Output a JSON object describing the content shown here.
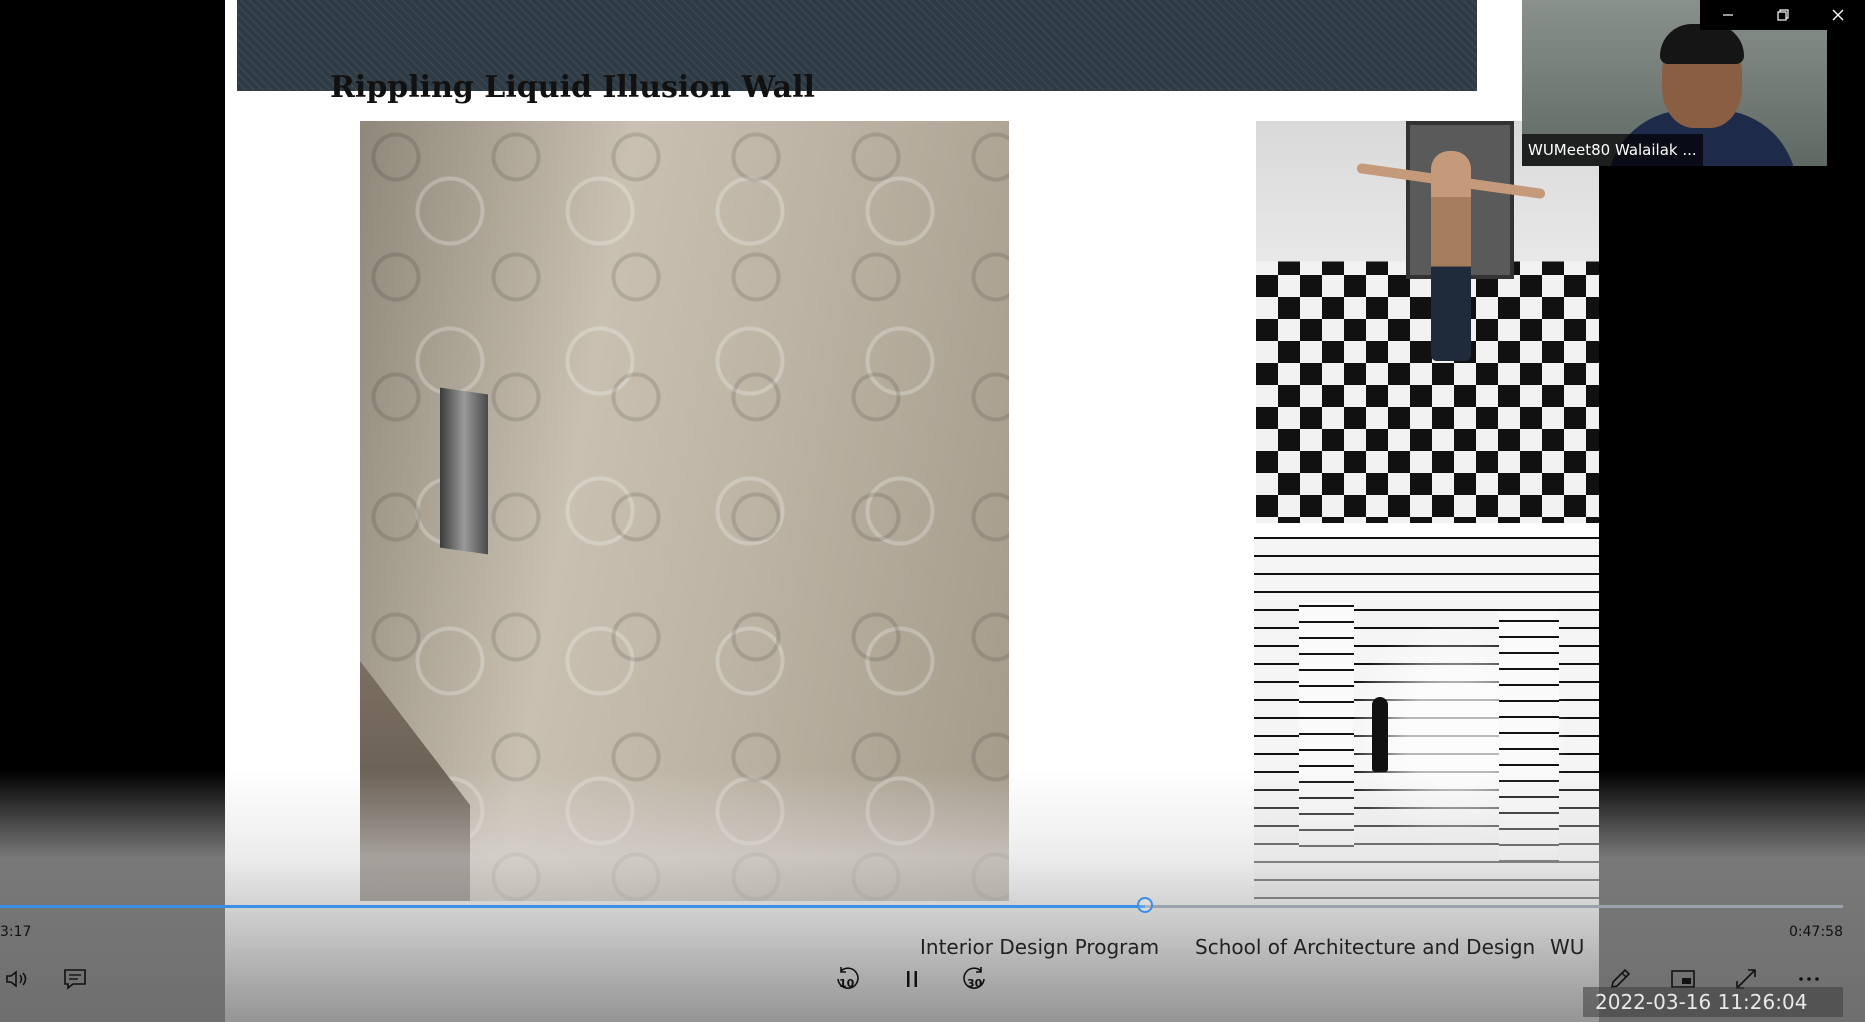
{
  "slide": {
    "title": "Rippling Liquid Illusion Wall"
  },
  "player": {
    "elapsed": "3:17",
    "total": "0:47:58",
    "progress_fraction": 0.621,
    "footer": {
      "program": "Interior Design Program",
      "school": "School of Architecture and Design",
      "org": "WU"
    },
    "skip_back": "10",
    "skip_forward": "30",
    "timestamp": "2022-03-16  11:26:04"
  },
  "participant": {
    "name": "WUMeet80 Walailak ..."
  },
  "colors": {
    "accent": "#3a8ee6",
    "banner": "#2e3b45"
  },
  "icons": [
    "volume-icon",
    "captions-icon",
    "rewind-10-icon",
    "pause-icon",
    "forward-30-icon",
    "pen-icon",
    "picture-in-picture-icon",
    "fullscreen-icon",
    "more-icon",
    "minimize-icon",
    "restore-icon",
    "close-icon"
  ]
}
